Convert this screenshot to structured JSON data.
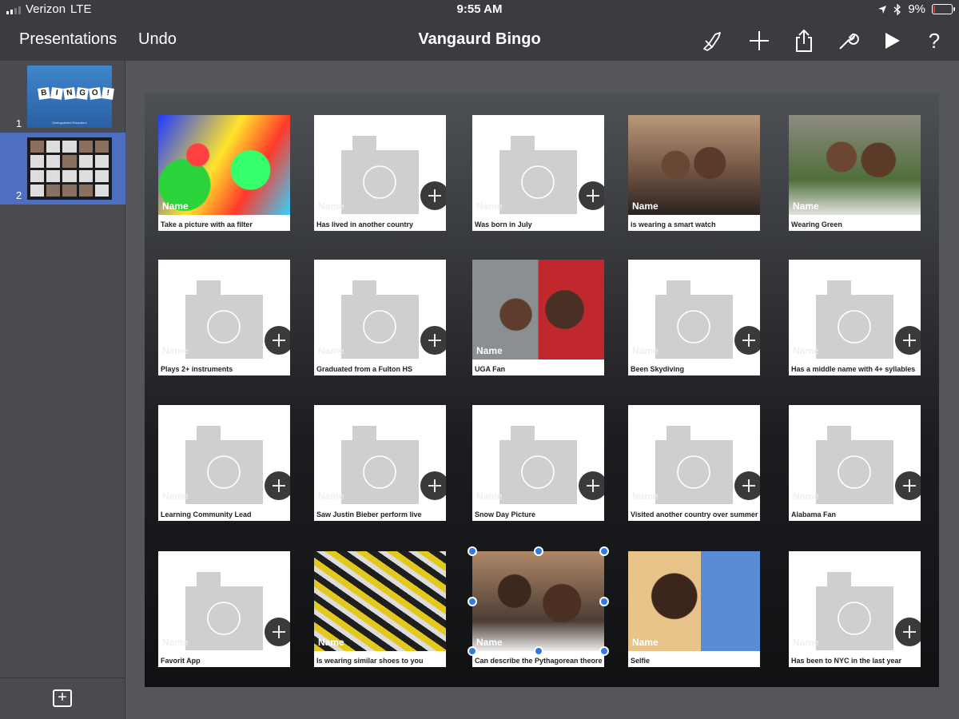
{
  "status_bar": {
    "carrier": "Verizon",
    "network": "LTE",
    "time": "9:55 AM",
    "battery_percent": "9%",
    "battery_level": 0.09
  },
  "toolbar": {
    "presentations_label": "Presentations",
    "undo_label": "Undo",
    "document_title": "Vangaurd Bingo",
    "icons": [
      "paintbrush-icon",
      "plus-icon",
      "share-icon",
      "wrench-icon",
      "play-icon",
      "help-icon"
    ],
    "help_glyph": "?"
  },
  "sidebar": {
    "slides": [
      {
        "number": "1",
        "selected": false,
        "letters": [
          "B",
          "I",
          "N",
          "G",
          "O",
          "!"
        ],
        "caption": "Distinguished Educators"
      },
      {
        "number": "2",
        "selected": true
      }
    ],
    "add_slide_glyph": "+"
  },
  "slide": {
    "name_placeholder": "Name",
    "add_glyph": "+",
    "cells": [
      {
        "caption": "Take a picture with aa filter",
        "image": "photo-filter"
      },
      {
        "caption": "Has lived in another country",
        "image": "placeholder"
      },
      {
        "caption": "Was born in July",
        "image": "placeholder"
      },
      {
        "caption": "is wearing a smart watch",
        "image": "photo-a"
      },
      {
        "caption": "Wearing Green",
        "image": "photo-b"
      },
      {
        "caption": "Plays 2+ instruments",
        "image": "placeholder"
      },
      {
        "caption": "Graduated from a Fulton HS",
        "image": "placeholder"
      },
      {
        "caption": "UGA Fan",
        "image": "photo-c"
      },
      {
        "caption": "Been Skydiving",
        "image": "placeholder"
      },
      {
        "caption": "Has a middle name with 4+ syllables",
        "image": "placeholder"
      },
      {
        "caption": "Learning Community Lead",
        "image": "placeholder"
      },
      {
        "caption": "Saw Justin Bieber perform live",
        "image": "placeholder"
      },
      {
        "caption": "Snow Day Picture",
        "image": "placeholder"
      },
      {
        "caption": "Visited another country over summer",
        "image": "placeholder"
      },
      {
        "caption": "Alabama Fan",
        "image": "placeholder"
      },
      {
        "caption": "Favorit App",
        "image": "placeholder",
        "spellcheck": true
      },
      {
        "caption": "Is wearing similar shoes to you",
        "image": "photo-d"
      },
      {
        "caption": "Can describe the Pythagorean theorem",
        "image": "photo-e",
        "selected": true
      },
      {
        "caption": "Selfie",
        "image": "photo-f"
      },
      {
        "caption": "Has been to NYC in the last year",
        "image": "placeholder"
      }
    ]
  }
}
